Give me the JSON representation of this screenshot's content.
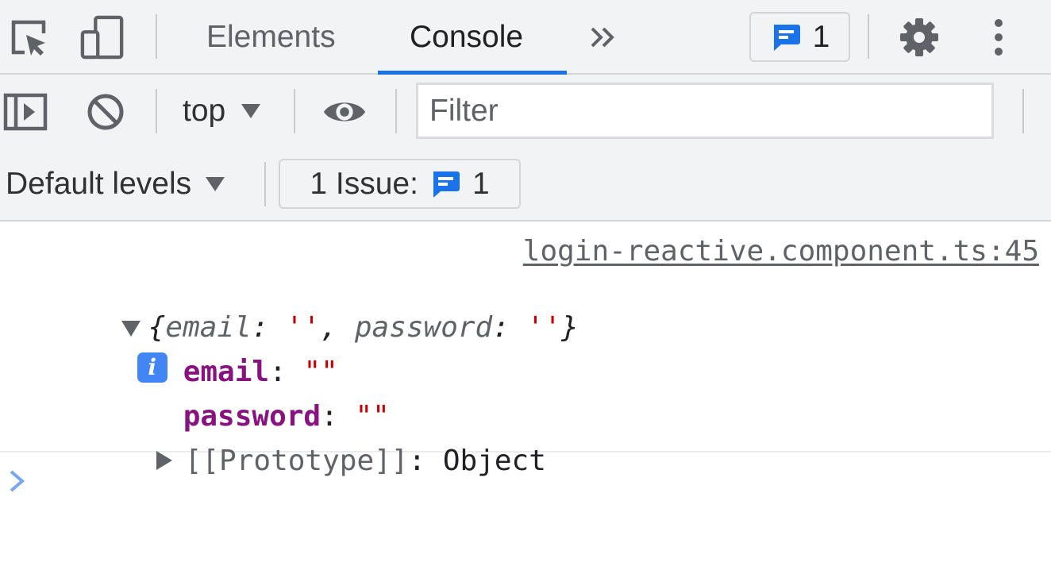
{
  "tabbar": {
    "tabs": [
      {
        "label": "Elements",
        "active": false
      },
      {
        "label": "Console",
        "active": true
      }
    ],
    "issues_count": "1",
    "icons": [
      "inspect-element-icon",
      "device-toolbar-icon",
      "more-tabs-icon",
      "settings-icon",
      "more-options-icon"
    ]
  },
  "toolbar": {
    "context": "top",
    "filter_placeholder": "Filter",
    "levels": "Default levels",
    "issues_label": "1 Issue:",
    "issues_count": "1"
  },
  "log": {
    "source": "login-reactive.component.ts:45",
    "summary": {
      "key1": "email",
      "val1": "''",
      "key2": "password",
      "val2": "''"
    },
    "properties": [
      {
        "key": "email",
        "value": "\"\""
      },
      {
        "key": "password",
        "value": "\"\""
      }
    ],
    "prototype_label": "[[Prototype]]",
    "prototype_value": "Object",
    "info_glyph": "i"
  },
  "colors": {
    "accent": "#1a73e8",
    "badge": "#4285f4",
    "string": "#c80000",
    "key": "#881280"
  }
}
